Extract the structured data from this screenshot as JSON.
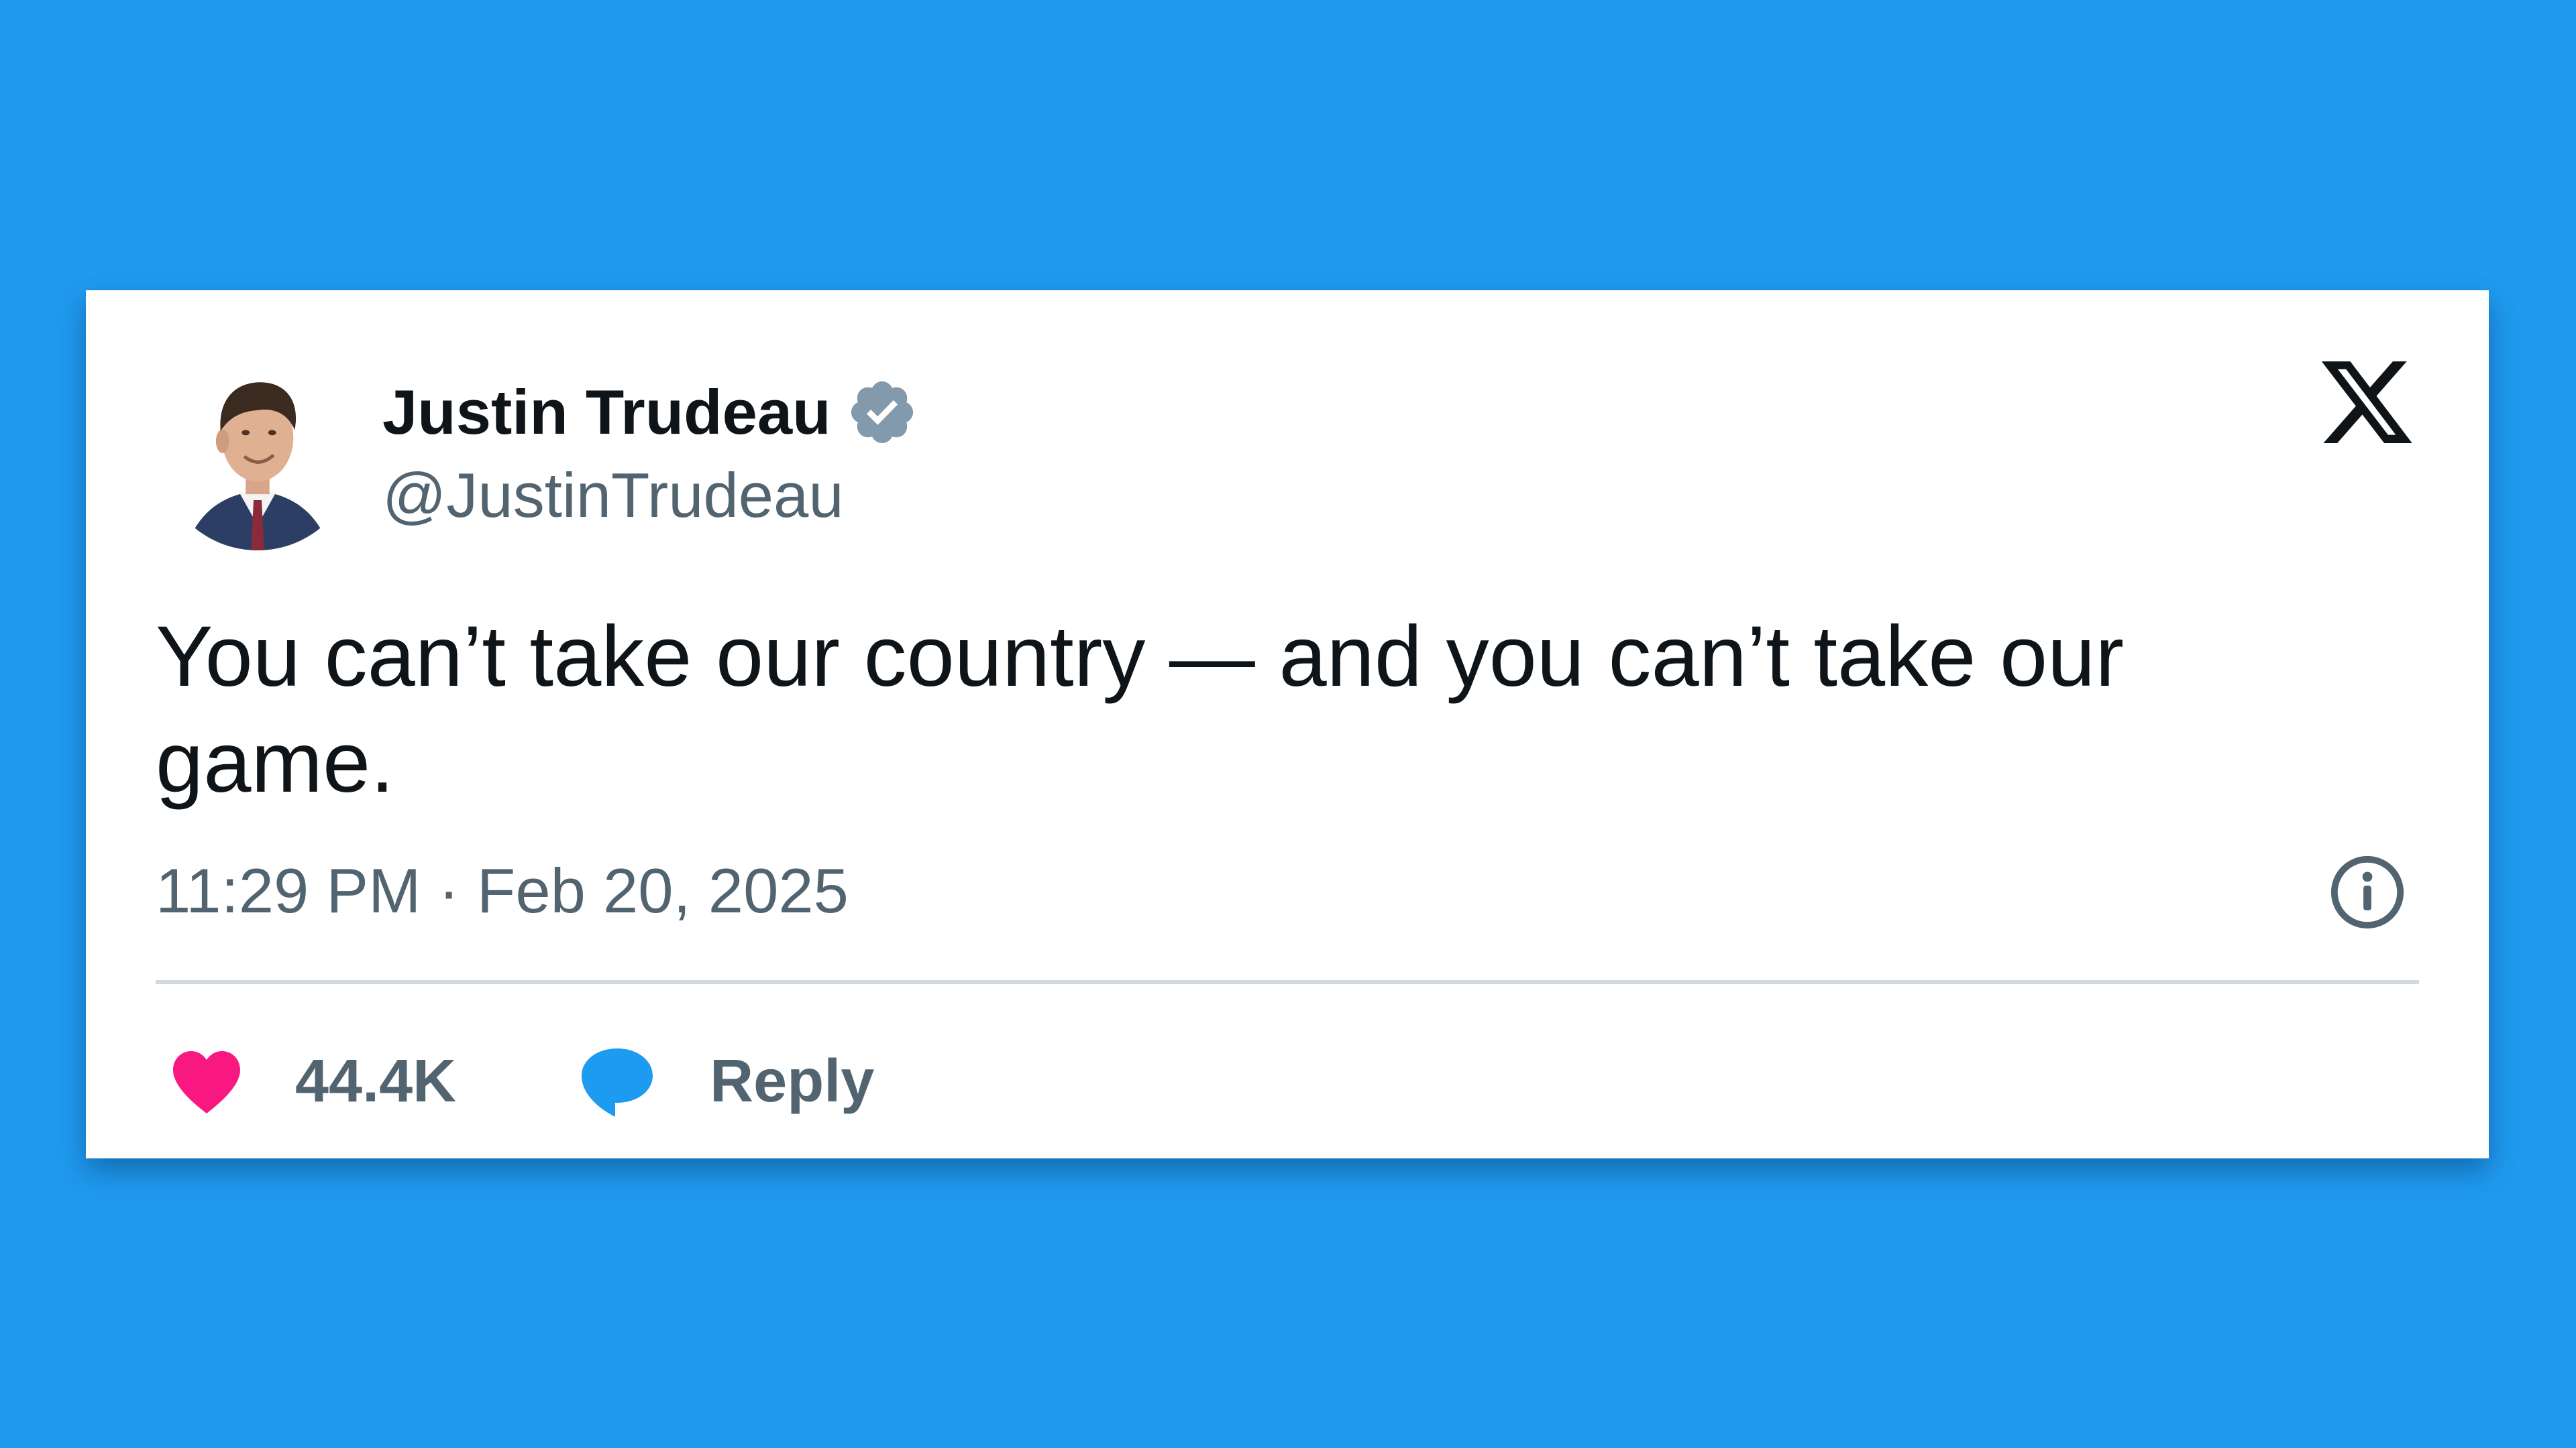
{
  "author": {
    "display_name": "Justin Trudeau",
    "handle": "@JustinTrudeau",
    "verified": true
  },
  "tweet": {
    "text": "You can’t take our country — and you can’t take our game.",
    "timestamp": "11:29 PM · Feb 20, 2025"
  },
  "actions": {
    "like_count": "44.4K",
    "reply_label": "Reply"
  },
  "icons": {
    "brand": "x-logo-icon",
    "verified": "verified-badge-icon",
    "info": "info-icon",
    "like": "heart-icon",
    "reply": "speech-bubble-icon"
  },
  "colors": {
    "background": "#1f9aee",
    "card": "#ffffff",
    "text_primary": "#0f1419",
    "text_secondary": "#536471",
    "verified_badge": "#829aab",
    "like": "#f91880",
    "reply": "#1d9bf0",
    "divider": "#cfd9de"
  }
}
